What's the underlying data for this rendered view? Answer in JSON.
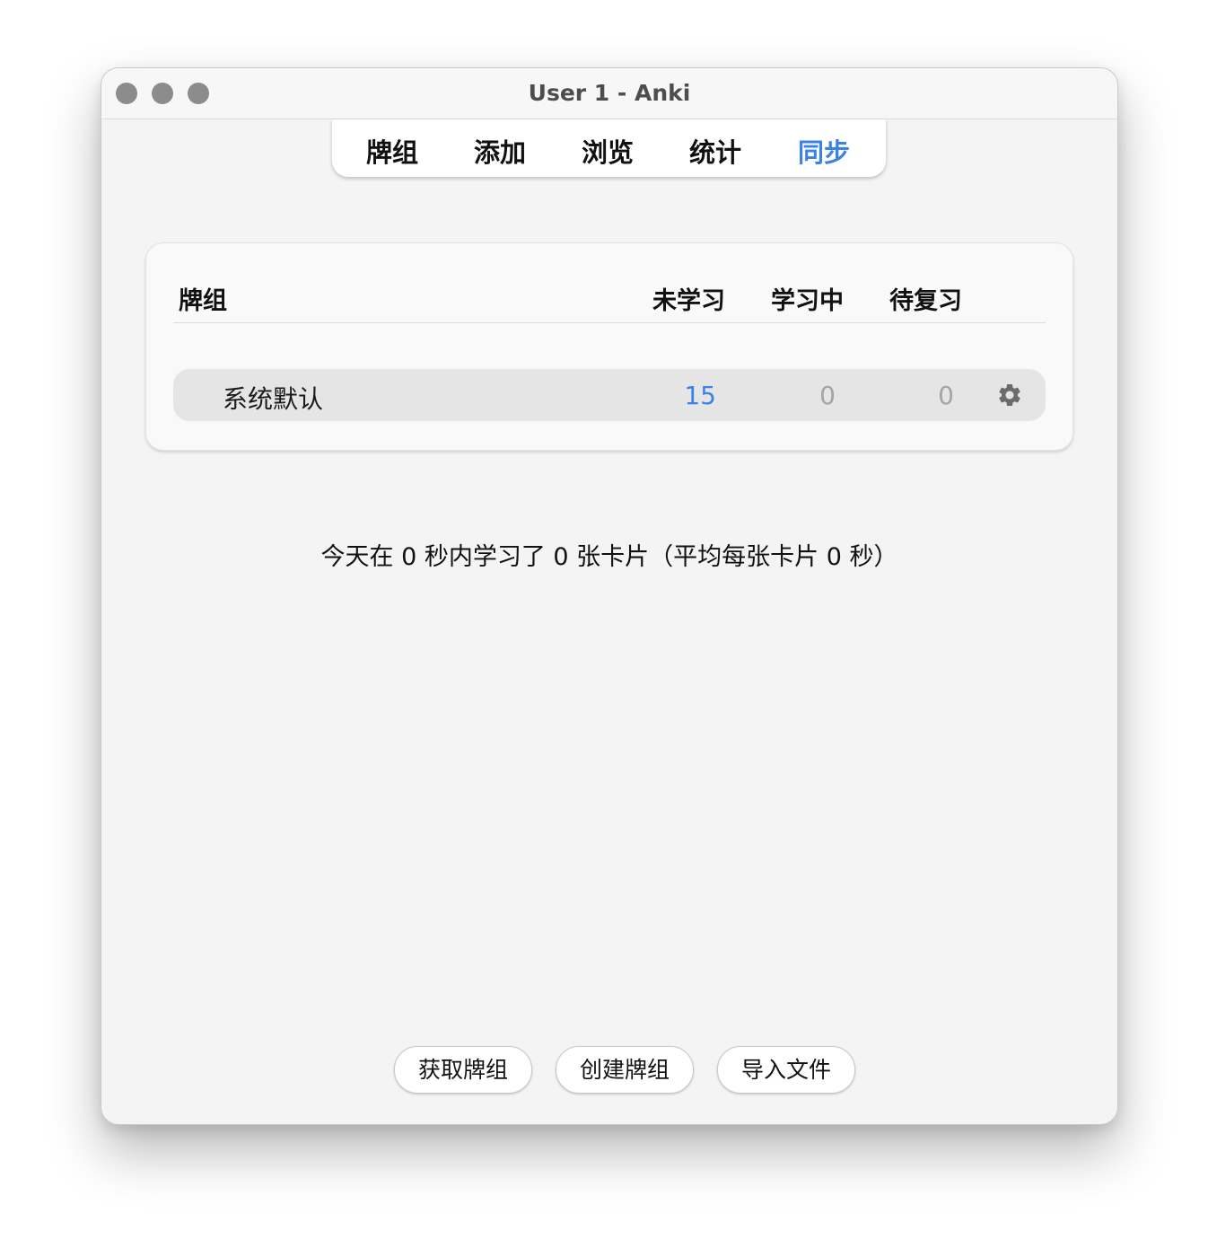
{
  "window": {
    "title": "User 1 - Anki"
  },
  "toolbar": {
    "items": [
      {
        "label": "牌组"
      },
      {
        "label": "添加"
      },
      {
        "label": "浏览"
      },
      {
        "label": "统计"
      },
      {
        "label": "同步"
      }
    ],
    "active_color": "#3b82e8"
  },
  "deck_list": {
    "headers": {
      "deck": "牌组",
      "new": "未学习",
      "learning": "学习中",
      "due": "待复习"
    },
    "rows": [
      {
        "name": "系统默认",
        "new": "15",
        "learning": "0",
        "due": "0",
        "options_icon": "gear-icon"
      }
    ],
    "colors": {
      "new": "#3b82e8",
      "zero": "#a5a5a5"
    }
  },
  "stats_text": "今天在 0 秒内学习了 0 张卡片（平均每张卡片 0 秒）",
  "buttons": {
    "get_shared": "获取牌组",
    "create_deck": "创建牌组",
    "import_file": "导入文件"
  }
}
